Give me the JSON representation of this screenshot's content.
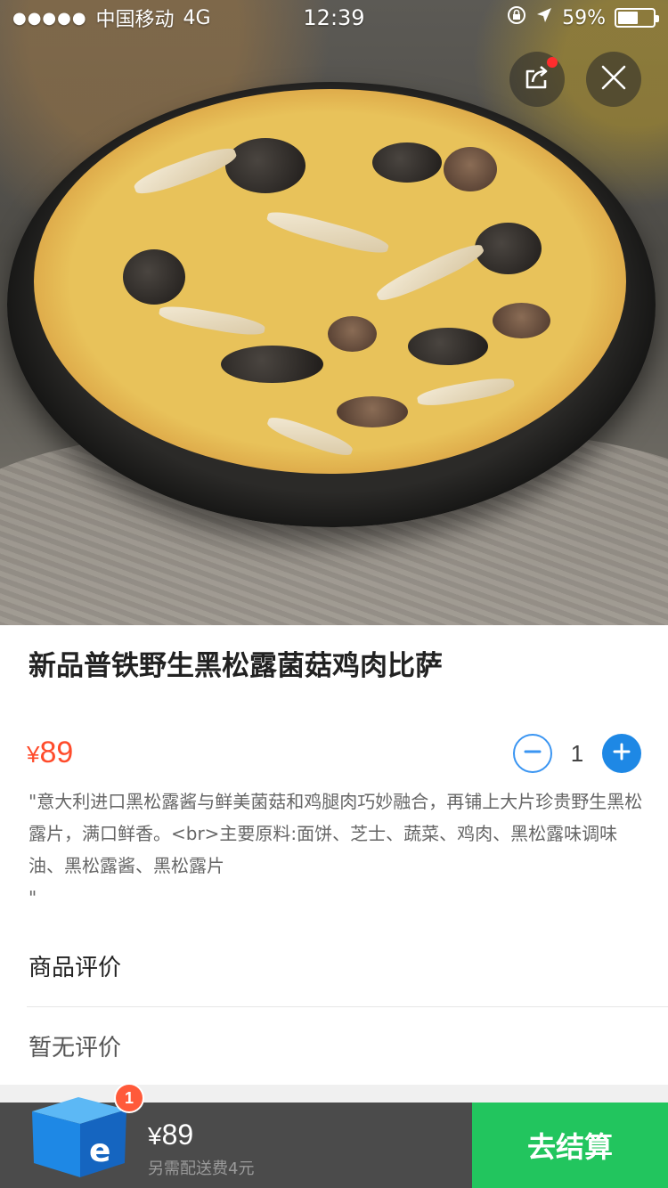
{
  "status_bar": {
    "signal_dots": "●●●●●",
    "carrier": "中国移动",
    "network": "4G",
    "time": "12:39",
    "battery_percent": "59%",
    "battery_level": 0.59
  },
  "hero": {
    "image": "pizza-photo"
  },
  "product": {
    "title": "新品普铁野生黑松露菌菇鸡肉比萨",
    "currency": "¥",
    "price": "89",
    "quantity": "1",
    "description": "\"意大利进口黑松露酱与鲜美菌菇和鸡腿肉巧妙融合，再铺上大片珍贵野生黑松露片，满口鲜香。<br>主要原料:面饼、芝士、蔬菜、鸡肉、黑松露味调味油、黑松露酱、黑松露片\n\""
  },
  "reviews": {
    "title": "商品评价",
    "empty_text": "暂无评价"
  },
  "cart": {
    "badge_count": "1",
    "currency": "¥",
    "total": "89",
    "delivery_note": "另需配送费4元",
    "checkout_label": "去结算"
  },
  "colors": {
    "price": "#ff4b2b",
    "accent_blue": "#1e88e5",
    "checkout_green": "#22c55e",
    "cart_bar": "#4b4b4b"
  }
}
